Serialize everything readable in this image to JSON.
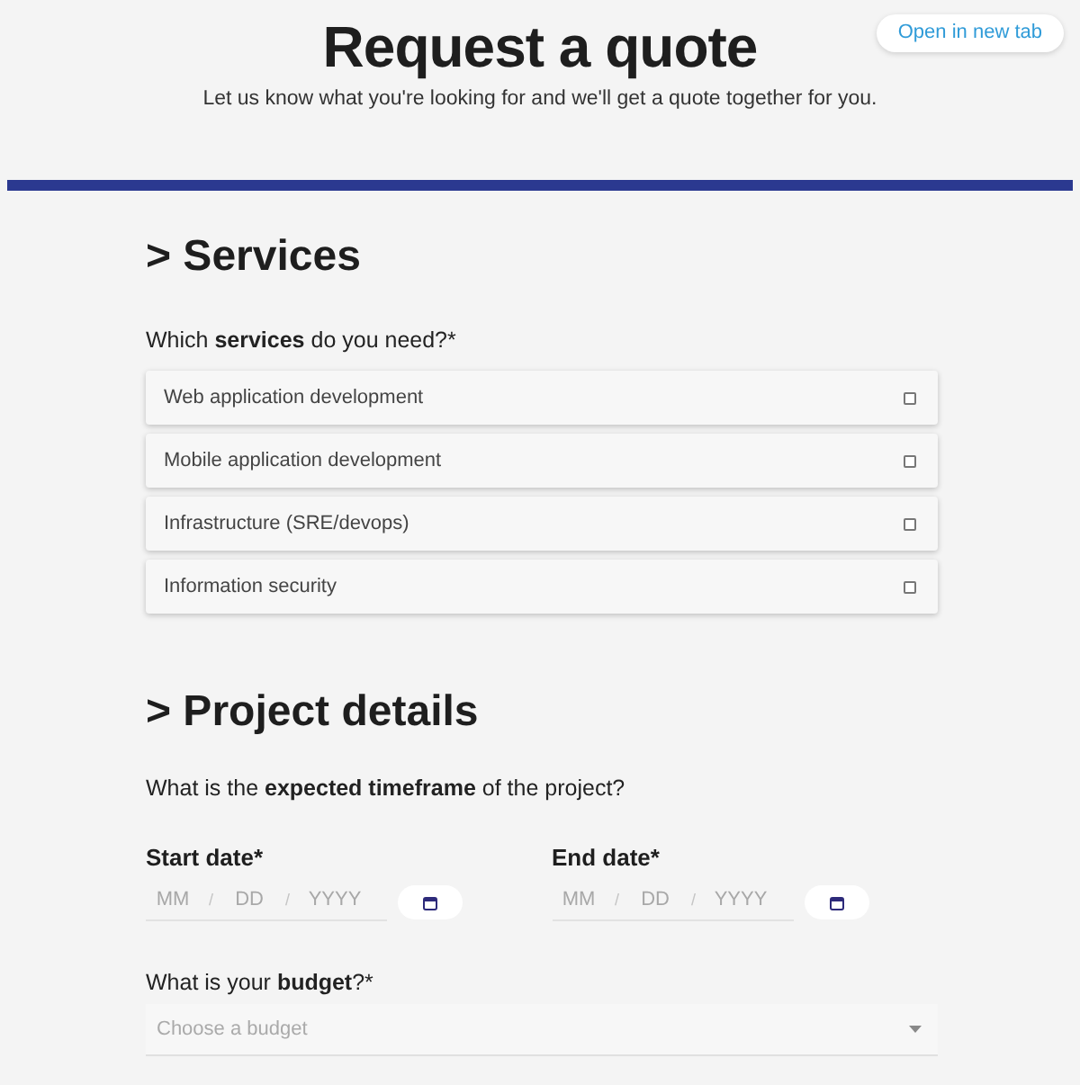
{
  "header": {
    "title": "Request a quote",
    "subtitle": "Let us know what you're looking for and we'll get a quote together for you.",
    "open_button": "Open in new tab"
  },
  "services": {
    "heading": "> Services",
    "question": "Which **services** do you need?*",
    "options": [
      {
        "label": "Web application development",
        "checked": false
      },
      {
        "label": "Mobile application development",
        "checked": false
      },
      {
        "label": "Infrastructure (SRE/devops)",
        "checked": false
      },
      {
        "label": "Information security",
        "checked": false
      }
    ]
  },
  "project_details": {
    "heading": "> Project details",
    "question": "What is the **expected timeframe** of the project?",
    "date_fields": [
      {
        "label": "Start date*",
        "parts": [
          {
            "placeholder": "MM"
          },
          {
            "placeholder": "DD"
          },
          {
            "placeholder": "YYYY"
          }
        ],
        "separators": [
          "/",
          "/"
        ]
      },
      {
        "label": "End date*",
        "parts": [
          {
            "placeholder": "MM"
          },
          {
            "placeholder": "DD"
          },
          {
            "placeholder": "YYYY"
          }
        ],
        "separators": [
          "/",
          "/"
        ]
      }
    ],
    "budget": {
      "question": "What is your **budget**?*",
      "placeholder": "Choose a budget"
    }
  }
}
